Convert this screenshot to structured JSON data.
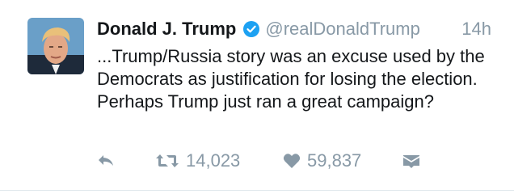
{
  "tweet": {
    "author_name": "Donald J. Trump",
    "handle": "@realDonaldTrump",
    "time": "14h",
    "body": "...Trump/Russia story was an excuse used by the Democrats as justification for losing the election. Perhaps Trump just ran a great campaign?",
    "retweets": "14,023",
    "likes": "59,837"
  },
  "icons": {
    "reply": "reply-icon",
    "retweet": "retweet-icon",
    "like": "heart-icon",
    "message": "direct-message-icon",
    "verified": "verified-badge-icon"
  },
  "colors": {
    "verified": "#1da1f2",
    "muted": "#8899a6",
    "text": "#14171a",
    "avatar_bg": "#6a9fc8"
  }
}
